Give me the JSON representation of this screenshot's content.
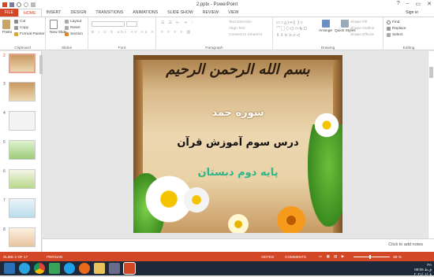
{
  "window": {
    "title": "2.pptx - PowerPoint",
    "minimize_icon": "minimize-icon",
    "restore_icon": "restore-icon",
    "close_icon": "close-icon"
  },
  "tabs": [
    "FILE",
    "HOME",
    "INSERT",
    "DESIGN",
    "TRANSITIONS",
    "ANIMATIONS",
    "SLIDE SHOW",
    "REVIEW",
    "VIEW"
  ],
  "signin": "Sign in",
  "ribbon": {
    "clipboard": {
      "label": "Clipboard",
      "paste": "Paste",
      "cut": "Cut",
      "copy": "Copy",
      "format_painter": "Format Painter"
    },
    "slides": {
      "label": "Slides",
      "new_slide": "New Slide",
      "layout": "Layout",
      "reset": "Reset",
      "section": "Section"
    },
    "font": {
      "label": "Font"
    },
    "paragraph": {
      "label": "Paragraph",
      "text_direction": "Text Direction",
      "align_text": "Align Text",
      "convert": "Convert to SmartArt"
    },
    "drawing": {
      "label": "Drawing",
      "arrange": "Arrange",
      "quick_styles": "Quick Styles",
      "shape_fill": "Shape Fill",
      "shape_outline": "Shape Outline",
      "shape_effects": "Shape Effects"
    },
    "editing": {
      "label": "Editing",
      "find": "Find",
      "replace": "Replace",
      "select": "Select"
    }
  },
  "thumbnails": [
    "2",
    "3",
    "4",
    "5",
    "6",
    "7",
    "8"
  ],
  "slide": {
    "bismillah": "بسم الله الرحمن الرحیم",
    "line1": "سوره حمد",
    "line2": "درس سوم آموزش قرآن",
    "line3": "پایه دوم دبستان",
    "color_line1": "#ffffff",
    "color_line2": "#111111",
    "color_line3": "#2fb58a"
  },
  "notes": "Click to add notes",
  "status": {
    "slide": "SLIDE 2 OF 17",
    "language": "PERSIAN",
    "notes_btn": "NOTES",
    "comments_btn": "COMMENTS",
    "zoom": "69 %"
  },
  "tray": {
    "time": "06:06 ق.ظ",
    "date": "۲۰۲۱/۰۱/۰۸",
    "lang": "FA"
  },
  "colors": {
    "accent": "#d24726"
  }
}
